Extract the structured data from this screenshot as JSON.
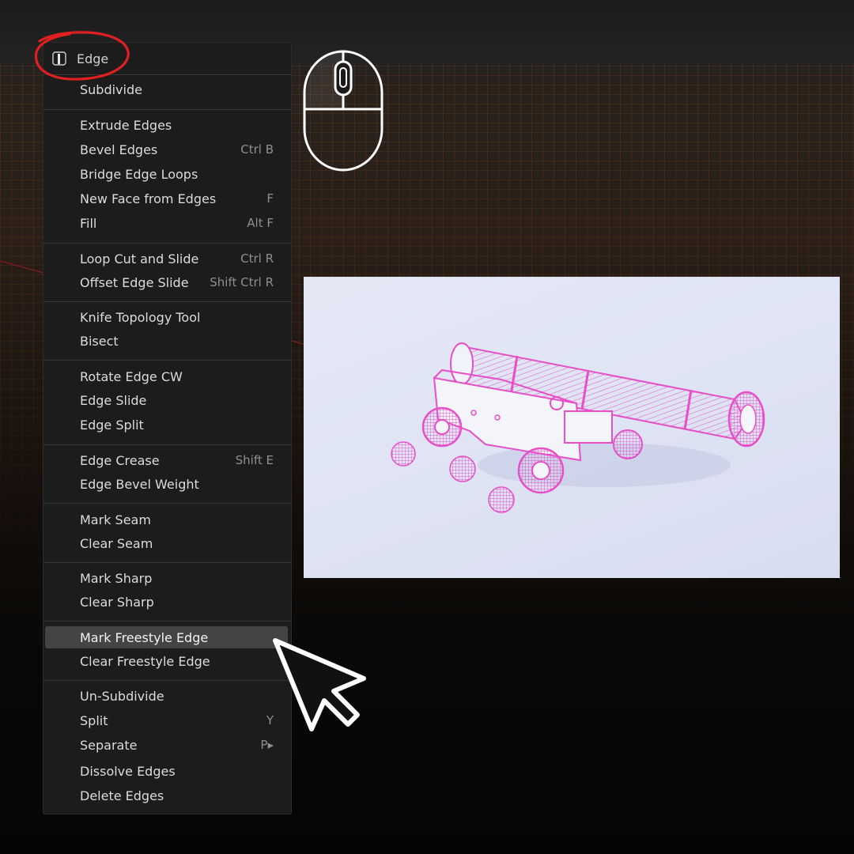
{
  "menu": {
    "title": "Edge",
    "icon": "edge-mode-icon",
    "groups": [
      [
        {
          "label": "Subdivide",
          "shortcut": ""
        }
      ],
      [
        {
          "label": "Extrude Edges",
          "shortcut": ""
        },
        {
          "label": "Bevel Edges",
          "shortcut": "Ctrl B"
        },
        {
          "label": "Bridge Edge Loops",
          "shortcut": ""
        },
        {
          "label": "New Face from Edges",
          "shortcut": "F"
        },
        {
          "label": "Fill",
          "shortcut": "Alt F"
        }
      ],
      [
        {
          "label": "Loop Cut and Slide",
          "shortcut": "Ctrl R"
        },
        {
          "label": "Offset Edge Slide",
          "shortcut": "Shift Ctrl R"
        }
      ],
      [
        {
          "label": "Knife Topology Tool",
          "shortcut": ""
        },
        {
          "label": "Bisect",
          "shortcut": ""
        }
      ],
      [
        {
          "label": "Rotate Edge CW",
          "shortcut": ""
        },
        {
          "label": "Edge Slide",
          "shortcut": ""
        },
        {
          "label": "Edge Split",
          "shortcut": ""
        }
      ],
      [
        {
          "label": "Edge Crease",
          "shortcut": "Shift E"
        },
        {
          "label": "Edge Bevel Weight",
          "shortcut": ""
        }
      ],
      [
        {
          "label": "Mark Seam",
          "shortcut": ""
        },
        {
          "label": "Clear Seam",
          "shortcut": ""
        }
      ],
      [
        {
          "label": "Mark Sharp",
          "shortcut": ""
        },
        {
          "label": "Clear Sharp",
          "shortcut": ""
        }
      ],
      [
        {
          "label": "Mark Freestyle Edge",
          "shortcut": "",
          "active": true
        },
        {
          "label": "Clear Freestyle Edge",
          "shortcut": ""
        }
      ],
      [
        {
          "label": "Un-Subdivide",
          "shortcut": ""
        },
        {
          "label": "Split",
          "shortcut": "Y"
        },
        {
          "label": "Separate",
          "shortcut": "P▸"
        },
        {
          "label": "Dissolve Edges",
          "shortcut": ""
        },
        {
          "label": "Delete Edges",
          "shortcut": ""
        }
      ]
    ]
  },
  "icons": {
    "mouse": "mouse-left-click-icon",
    "cursor": "arrow-cursor-icon"
  },
  "preview": {
    "subject": "cannon-render",
    "line_color": "#e64fc8",
    "background": "#e0e5f4"
  },
  "colors": {
    "annotation_circle": "#e02020",
    "menu_bg": "#1c1c1c",
    "highlight": "#444444"
  }
}
